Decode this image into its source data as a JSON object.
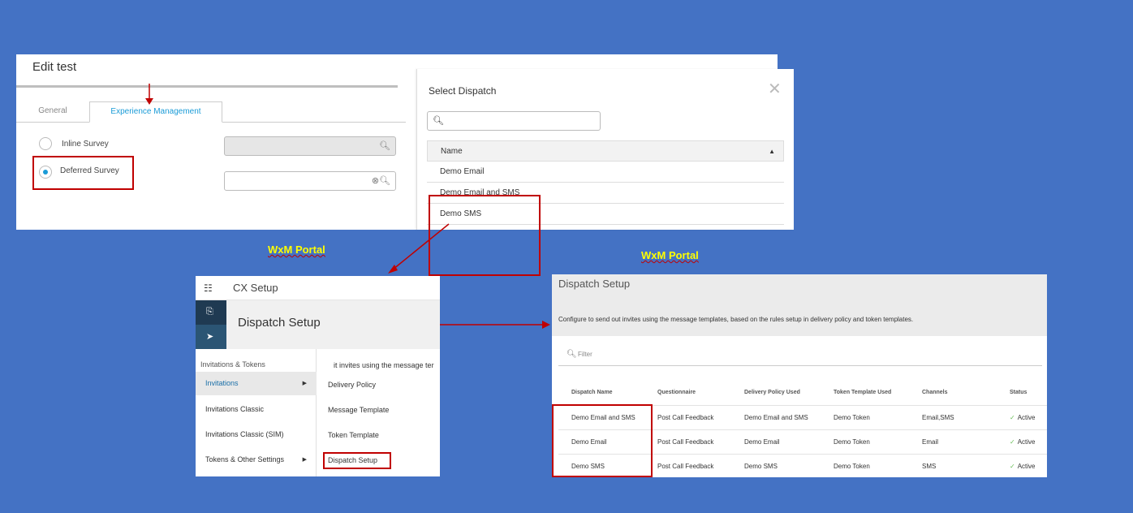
{
  "edit_panel": {
    "title": "Edit test",
    "tabs": [
      {
        "label": "General"
      },
      {
        "label": "Experience Management"
      }
    ],
    "options": [
      {
        "label": "Inline Survey",
        "selected": false
      },
      {
        "label": "Deferred Survey",
        "selected": true
      }
    ]
  },
  "select_dispatch": {
    "title": "Select Dispatch",
    "close_icon": "close-icon",
    "column": "Name",
    "sort_glyph": "▲",
    "rows": [
      "Demo Email",
      "Demo Email and SMS",
      "Demo SMS"
    ]
  },
  "label_left": "WxM Portal",
  "label_right": "WxM Portal",
  "cx_setup": {
    "app_title": "CX Setup",
    "page_title": "Dispatch Setup",
    "behind_text": "it invites using the message ter",
    "menu_header": "Invitations & Tokens",
    "menu_items": [
      "Invitations",
      "Invitations Classic",
      "Invitations Classic (SIM)",
      "Tokens & Other Settings"
    ],
    "submenu_items": [
      "Delivery Policy",
      "Message Template",
      "Token Template",
      "Dispatch Setup"
    ]
  },
  "dispatch_setup": {
    "title": "Dispatch Setup",
    "description": "Configure to send out invites using the message templates, based on the rules setup in delivery policy and token templates.",
    "filter_placeholder": "Filter",
    "columns": [
      "Dispatch Name",
      "Questionnaire",
      "Delivery Policy Used",
      "Token Template Used",
      "Channels",
      "Status"
    ],
    "rows": [
      [
        "Demo Email and SMS",
        "Post Call Feedback",
        "Demo Email and SMS",
        "Demo Token",
        "Email,SMS",
        "Active"
      ],
      [
        "Demo Email",
        "Post Call Feedback",
        "Demo Email",
        "Demo Token",
        "Email",
        "Active"
      ],
      [
        "Demo SMS",
        "Post Call Feedback",
        "Demo SMS",
        "Demo Token",
        "SMS",
        "Active"
      ]
    ]
  },
  "colors": {
    "background": "#4472c4",
    "highlight": "#c00000",
    "accent": "#1a9bd7",
    "label": "#ffff00"
  }
}
